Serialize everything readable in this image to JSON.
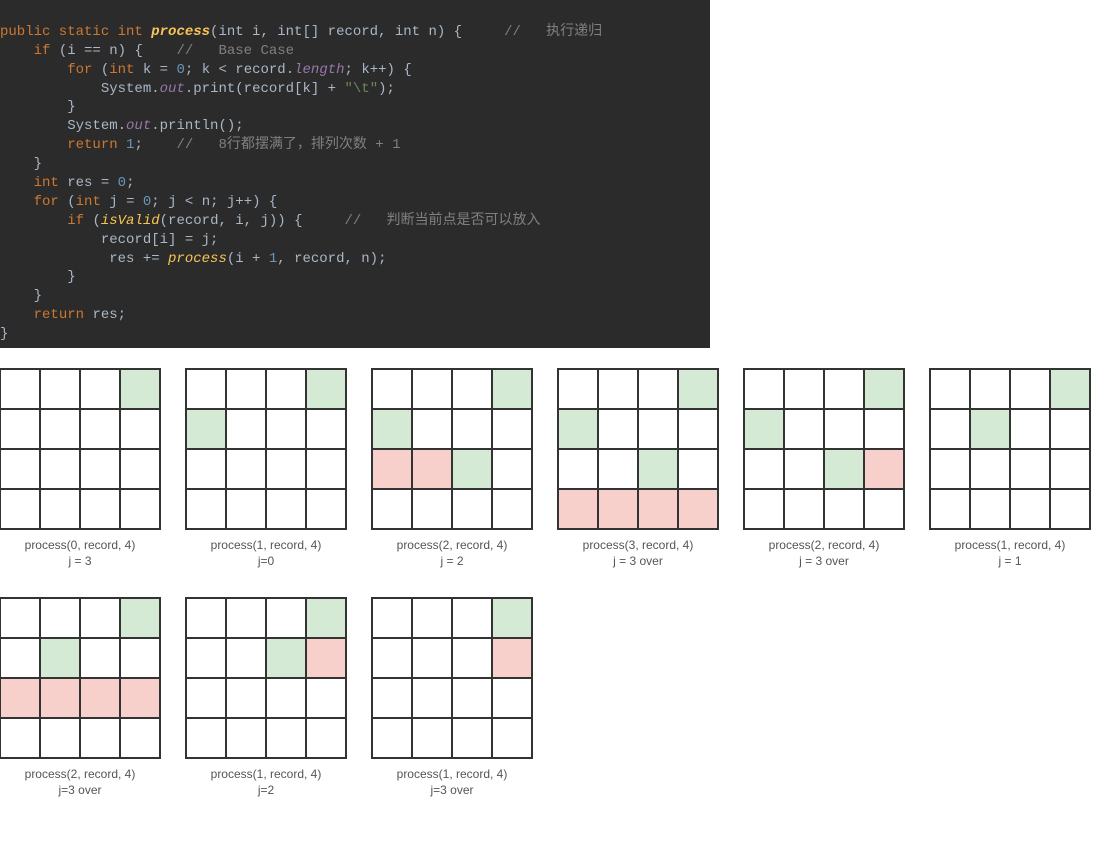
{
  "code": {
    "line1_kw1": "public static int",
    "line1_fn": "process",
    "line1_params": "(int i, int[] record, int n) {",
    "line1_cmt": "//   执行递归",
    "line2_if": "if",
    "line2_cond": "(i == n) {",
    "line2_cmt": "//   Base Case",
    "line3_for": "for",
    "line3_rest": "(int k = 0; k < record.length; k++) {",
    "line4": "System.out.print(record[k] + \"\\t\");",
    "line5": "}",
    "line6": "System.out.println();",
    "line7_ret": "return",
    "line7_val": "1",
    "line7_semi": ";",
    "line7_cmt": "//   8行都摆满了，排列次数 + 1",
    "line8": "}",
    "line9_int": "int",
    "line9_rest": "res = 0;",
    "line10_for": "for",
    "line10_rest": "(int j = 0; j < n; j++) {",
    "line11_if": "if",
    "line11_open": "(",
    "line11_fn": "isValid",
    "line11_args": "(record, i, j)) {",
    "line11_cmt": "//   判断当前点是否可以放入",
    "line12": "record[i] = j;",
    "line13_a": "res += ",
    "line13_fn": "process",
    "line13_args": "(i + 1, record, n);",
    "line14": "}",
    "line15": "}",
    "line16_ret": "return",
    "line16_rest": "res;",
    "line17": "}"
  },
  "chart_data": {
    "type": "grid-diagram",
    "description": "N-Queens recursion trace on 4x4 boards. g=green(placed queen), r=red(invalid attempted)",
    "grids": [
      {
        "cells": [
          [
            "",
            "",
            "",
            "g"
          ],
          [
            "",
            "",
            "",
            ""
          ],
          [
            "",
            "",
            "",
            ""
          ],
          [
            "",
            "",
            "",
            ""
          ]
        ],
        "caption1": "process(0, record, 4)",
        "caption2": "j = 3"
      },
      {
        "cells": [
          [
            "",
            "",
            "",
            "g"
          ],
          [
            "g",
            "",
            "",
            ""
          ],
          [
            "",
            "",
            "",
            ""
          ],
          [
            "",
            "",
            "",
            ""
          ]
        ],
        "caption1": "process(1, record, 4)",
        "caption2": "j=0"
      },
      {
        "cells": [
          [
            "",
            "",
            "",
            "g"
          ],
          [
            "g",
            "",
            "",
            ""
          ],
          [
            "r",
            "r",
            "g",
            ""
          ],
          [
            "",
            "",
            "",
            ""
          ]
        ],
        "caption1": "process(2, record, 4)",
        "caption2": "j = 2"
      },
      {
        "cells": [
          [
            "",
            "",
            "",
            "g"
          ],
          [
            "g",
            "",
            "",
            ""
          ],
          [
            "",
            "",
            "g",
            ""
          ],
          [
            "r",
            "r",
            "r",
            "r"
          ]
        ],
        "caption1": "process(3, record, 4)",
        "caption2": "j = 3 over"
      },
      {
        "cells": [
          [
            "",
            "",
            "",
            "g"
          ],
          [
            "g",
            "",
            "",
            ""
          ],
          [
            "",
            "",
            "g",
            "r"
          ],
          [
            "",
            "",
            "",
            ""
          ]
        ],
        "caption1": "process(2, record, 4)",
        "caption2": "j = 3 over"
      },
      {
        "cells": [
          [
            "",
            "",
            "",
            "g"
          ],
          [
            "",
            "g",
            "",
            ""
          ],
          [
            "",
            "",
            "",
            ""
          ],
          [
            "",
            "",
            "",
            ""
          ]
        ],
        "caption1": "process(1, record, 4)",
        "caption2": "j = 1"
      },
      {
        "cells": [
          [
            "",
            "",
            "",
            "g"
          ],
          [
            "",
            "g",
            "",
            ""
          ],
          [
            "r",
            "r",
            "r",
            "r"
          ],
          [
            "",
            "",
            "",
            ""
          ]
        ],
        "caption1": "process(2, record, 4)",
        "caption2": "j=3 over"
      },
      {
        "cells": [
          [
            "",
            "",
            "",
            "g"
          ],
          [
            "",
            "",
            "g",
            "r"
          ],
          [
            "",
            "",
            "",
            ""
          ],
          [
            "",
            "",
            "",
            ""
          ]
        ],
        "caption1": "process(1, record, 4)",
        "caption2": "j=2"
      },
      {
        "cells": [
          [
            "",
            "",
            "",
            "g"
          ],
          [
            "",
            "",
            "",
            "r"
          ],
          [
            "",
            "",
            "",
            ""
          ],
          [
            "",
            "",
            "",
            ""
          ]
        ],
        "caption1": "process(1, record, 4)",
        "caption2": "j=3 over"
      }
    ]
  }
}
